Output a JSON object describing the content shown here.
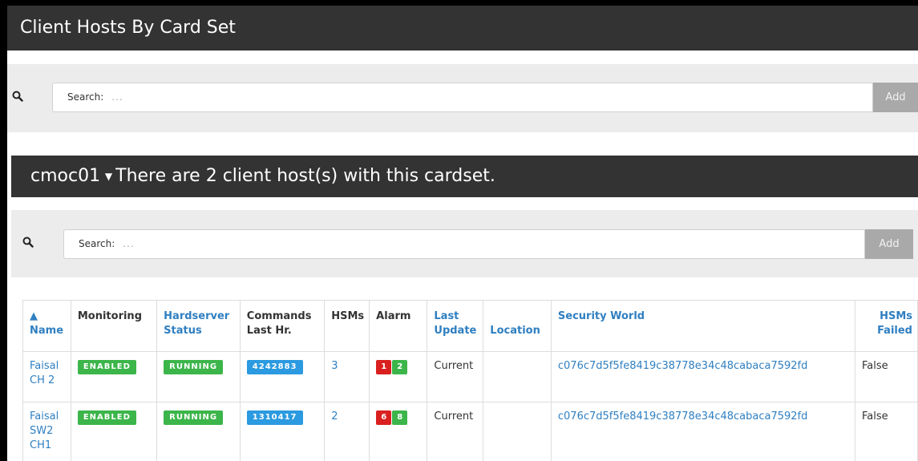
{
  "page": {
    "title": "Client Hosts By Card Set"
  },
  "top_search": {
    "label": "Search:",
    "placeholder": "...",
    "add_label": "Add"
  },
  "cardset": {
    "name": "cmoc01",
    "description": "There are 2 client host(s) with this cardset."
  },
  "inner_search": {
    "label": "Search:",
    "placeholder": "...",
    "add_label": "Add"
  },
  "table": {
    "sort_indicator": "▲",
    "headers": {
      "name": "Name",
      "monitoring": "Monitoring",
      "hardserver_status": [
        "Hardserver",
        "Status"
      ],
      "commands": [
        "Commands",
        "Last Hr."
      ],
      "hsms": "HSMs",
      "alarm": "Alarm",
      "last_update": [
        "Last",
        "Update"
      ],
      "location": "Location",
      "security_world": "Security World",
      "hsms_failed": [
        "HSMs",
        "Failed"
      ]
    },
    "rows": [
      {
        "name": [
          "Faisal",
          "CH 2"
        ],
        "monitoring": "ENABLED",
        "hardserver_status": "RUNNING",
        "commands": "4242883",
        "hsms": "3",
        "alarm_red": "1",
        "alarm_green": "2",
        "last_update": "Current",
        "location": "",
        "security_world": "c076c7d5f5fe8419c38778e34c48cabaca7592fd",
        "hsms_failed": "False"
      },
      {
        "name": [
          "Faisal",
          "SW2",
          "CH1"
        ],
        "monitoring": "ENABLED",
        "hardserver_status": "RUNNING",
        "commands": "1310417",
        "hsms": "2",
        "alarm_red": "6",
        "alarm_green": "8",
        "last_update": "Current",
        "location": "",
        "security_world": "c076c7d5f5fe8419c38778e34c48cabaca7592fd",
        "hsms_failed": "False"
      }
    ]
  },
  "colors": {
    "header_bg": "#333333",
    "band_bg": "#ececec",
    "link": "#2f7fc1",
    "badge_green": "#3cb54a",
    "badge_blue": "#2b9ae0",
    "alarm_red": "#d9201f"
  }
}
